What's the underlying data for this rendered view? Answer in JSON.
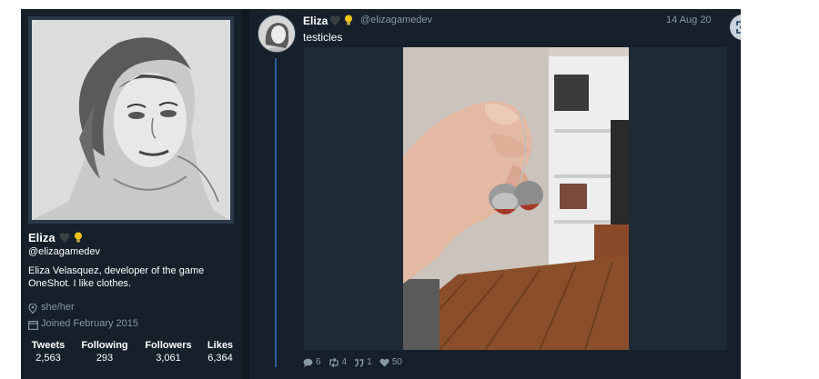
{
  "profile": {
    "name": "Eliza",
    "handle": "@elizagamedev",
    "bio_line1": "Eliza Velasquez, developer of the game",
    "bio_line2": "OneShot. I like clothes.",
    "pronouns": "she/her",
    "joined": "Joined February 2015",
    "badges": [
      "black-heart-icon",
      "lightbulb-icon"
    ],
    "stats": [
      {
        "label": "Tweets",
        "value": "2,563"
      },
      {
        "label": "Following",
        "value": "293"
      },
      {
        "label": "Followers",
        "value": "3,061"
      },
      {
        "label": "Likes",
        "value": "6,364"
      }
    ]
  },
  "tweet": {
    "name": "Eliza",
    "handle": "@elizagamedev",
    "date": "14 Aug 20",
    "text": "testicles",
    "badges": [
      "black-heart-icon",
      "lightbulb-icon"
    ],
    "actions": {
      "replies": "6",
      "retweets": "4",
      "quotes": "1",
      "likes": "50"
    }
  },
  "colors": {
    "background": "#15202b",
    "accent_line": "#2b5f9e",
    "muted_text": "#8899a6"
  }
}
